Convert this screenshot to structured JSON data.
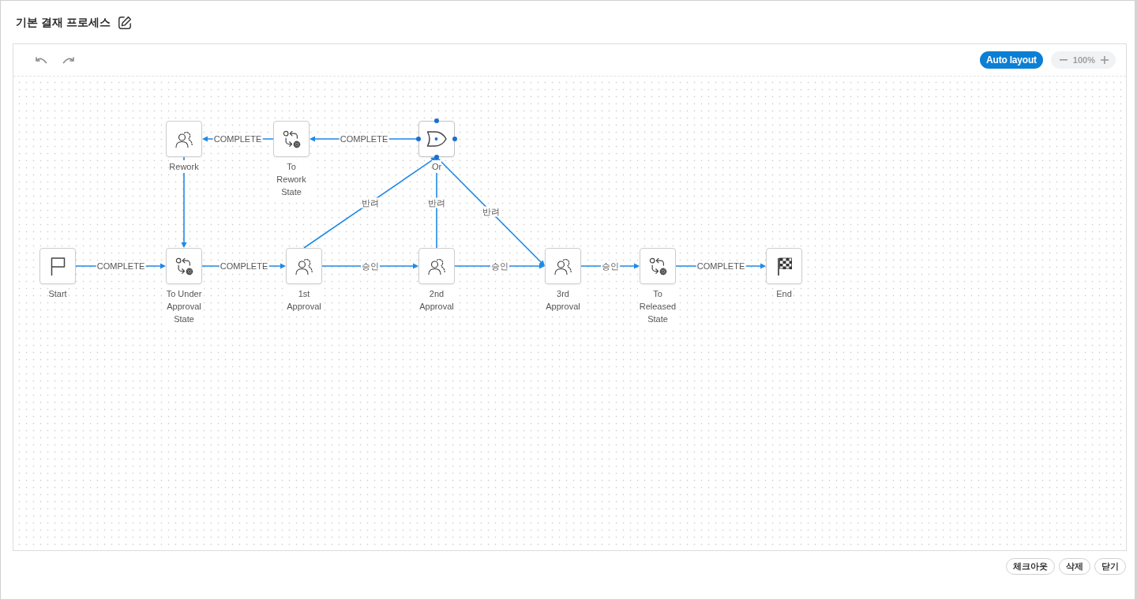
{
  "title": "기본 결재 프로세스",
  "toolbar": {
    "auto_layout": "Auto layout",
    "zoom": "100%"
  },
  "nodes": [
    {
      "kind": "task",
      "label": "Rework",
      "selected": false
    },
    {
      "kind": "state",
      "label": "To Rework State",
      "selected": false
    },
    {
      "kind": "gateway",
      "label": "Or",
      "selected": true
    },
    {
      "kind": "start",
      "label": "Start",
      "selected": false
    },
    {
      "kind": "state",
      "label": "To Under Approval State",
      "selected": false
    },
    {
      "kind": "task",
      "label": "1st Approval",
      "selected": false
    },
    {
      "kind": "task",
      "label": "2nd Approval",
      "selected": false
    },
    {
      "kind": "task",
      "label": "3rd Approval",
      "selected": false
    },
    {
      "kind": "state",
      "label": "To Released State",
      "selected": false
    },
    {
      "kind": "end",
      "label": "End",
      "selected": false
    }
  ],
  "edges": [
    {
      "label": "COMPLETE",
      "arrowhead": true
    },
    {
      "label": "COMPLETE",
      "arrowhead": true
    },
    {
      "arrowhead": true
    },
    {
      "label": "COMPLETE",
      "arrowhead": true
    },
    {
      "label": "COMPLETE",
      "arrowhead": true
    },
    {
      "label": "반려",
      "arrowhead": true
    },
    {
      "label": "승인",
      "arrowhead": true
    },
    {
      "label": "반려",
      "arrowhead": true
    },
    {
      "label": "승인",
      "arrowhead": true
    },
    {
      "label": "반려",
      "arrowhead": true
    },
    {
      "label": "승인",
      "arrowhead": true
    },
    {
      "label": "COMPLETE",
      "arrowhead": true
    }
  ],
  "footer_buttons": [
    "체크아웃",
    "삭제",
    "닫기"
  ]
}
